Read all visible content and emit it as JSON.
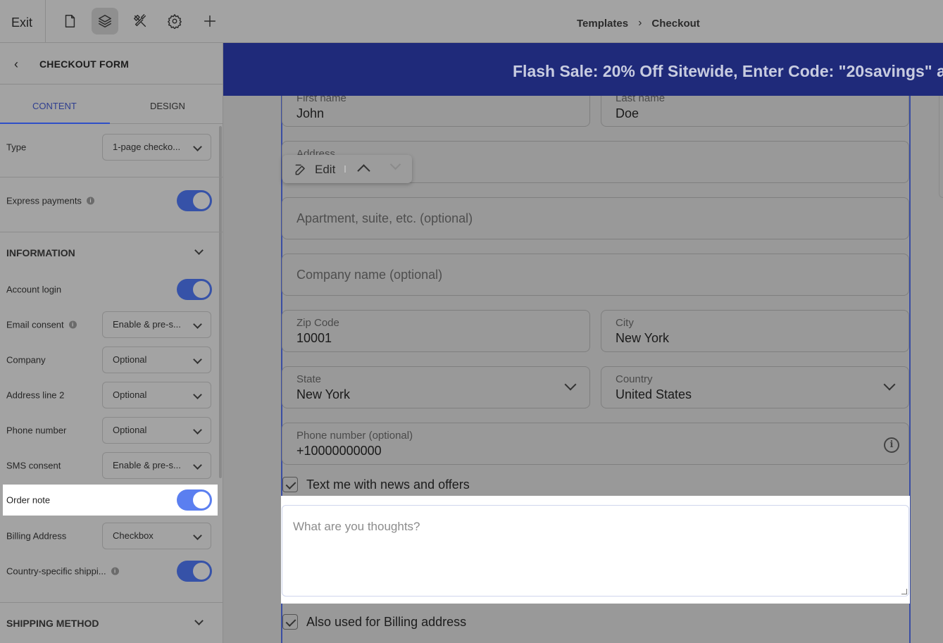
{
  "topbar": {
    "exit_label": "Exit",
    "icons": [
      "page-icon",
      "layers-icon",
      "tools-icon",
      "gear-icon",
      "plus-icon"
    ],
    "breadcrumb": [
      "Templates",
      "Checkout"
    ]
  },
  "sidebar": {
    "back_icon": "chevron-left-icon",
    "title": "CHECKOUT FORM",
    "tabs": [
      "CONTENT",
      "DESIGN"
    ],
    "active_tab": "CONTENT",
    "rows": [
      {
        "label": "Type",
        "control": "select",
        "value": "1-page checko..."
      },
      {
        "label": "Express payments",
        "info": true,
        "control": "toggle",
        "on": true
      }
    ],
    "information_title": "INFORMATION",
    "information_rows": [
      {
        "label": "Account login",
        "control": "toggle",
        "on": true
      },
      {
        "label": "Email consent",
        "info": true,
        "control": "select",
        "value": "Enable & pre-s..."
      },
      {
        "label": "Company",
        "control": "select",
        "value": "Optional"
      },
      {
        "label": "Address line 2",
        "control": "select",
        "value": "Optional"
      },
      {
        "label": "Phone number",
        "control": "select",
        "value": "Optional"
      },
      {
        "label": "SMS consent",
        "control": "select",
        "value": "Enable & pre-s..."
      },
      {
        "label": "Order note",
        "control": "toggle",
        "on": true,
        "highlighted": true
      },
      {
        "label": "Billing Address",
        "control": "select",
        "value": "Checkbox"
      },
      {
        "label": "Country-specific shippi...",
        "info": true,
        "control": "toggle",
        "on": true
      }
    ],
    "shipping_title": "SHIPPING METHOD"
  },
  "banner": {
    "text": "Flash Sale: 20% Off Sitewide, Enter Code: \"20savings\" a"
  },
  "form": {
    "first_name": {
      "label": "First name",
      "value": "John"
    },
    "last_name": {
      "label": "Last name",
      "value": "Doe"
    },
    "address": {
      "label": "Address"
    },
    "apartment": {
      "placeholder": "Apartment, suite, etc. (optional)"
    },
    "company": {
      "placeholder": "Company name (optional)"
    },
    "zip": {
      "label": "Zip Code",
      "value": "10001"
    },
    "city": {
      "label": "City",
      "value": "New York"
    },
    "state": {
      "label": "State",
      "value": "New York"
    },
    "country": {
      "label": "Country",
      "value": "United States"
    },
    "phone": {
      "label": "Phone number (optional)",
      "value": "+10000000000"
    },
    "sms_checkbox": {
      "label": "Text me with news and offers",
      "checked": true
    },
    "order_note": {
      "placeholder": "What are you thoughts?"
    },
    "billing_checkbox": {
      "label": "Also used for Billing address",
      "checked": true
    }
  },
  "edit_popover": {
    "label": "Edit"
  },
  "colors": {
    "overlay": "#999999",
    "banner": "#1f2a7a",
    "accent": "#3652a8",
    "toggle_active": "#5b7ff0"
  }
}
